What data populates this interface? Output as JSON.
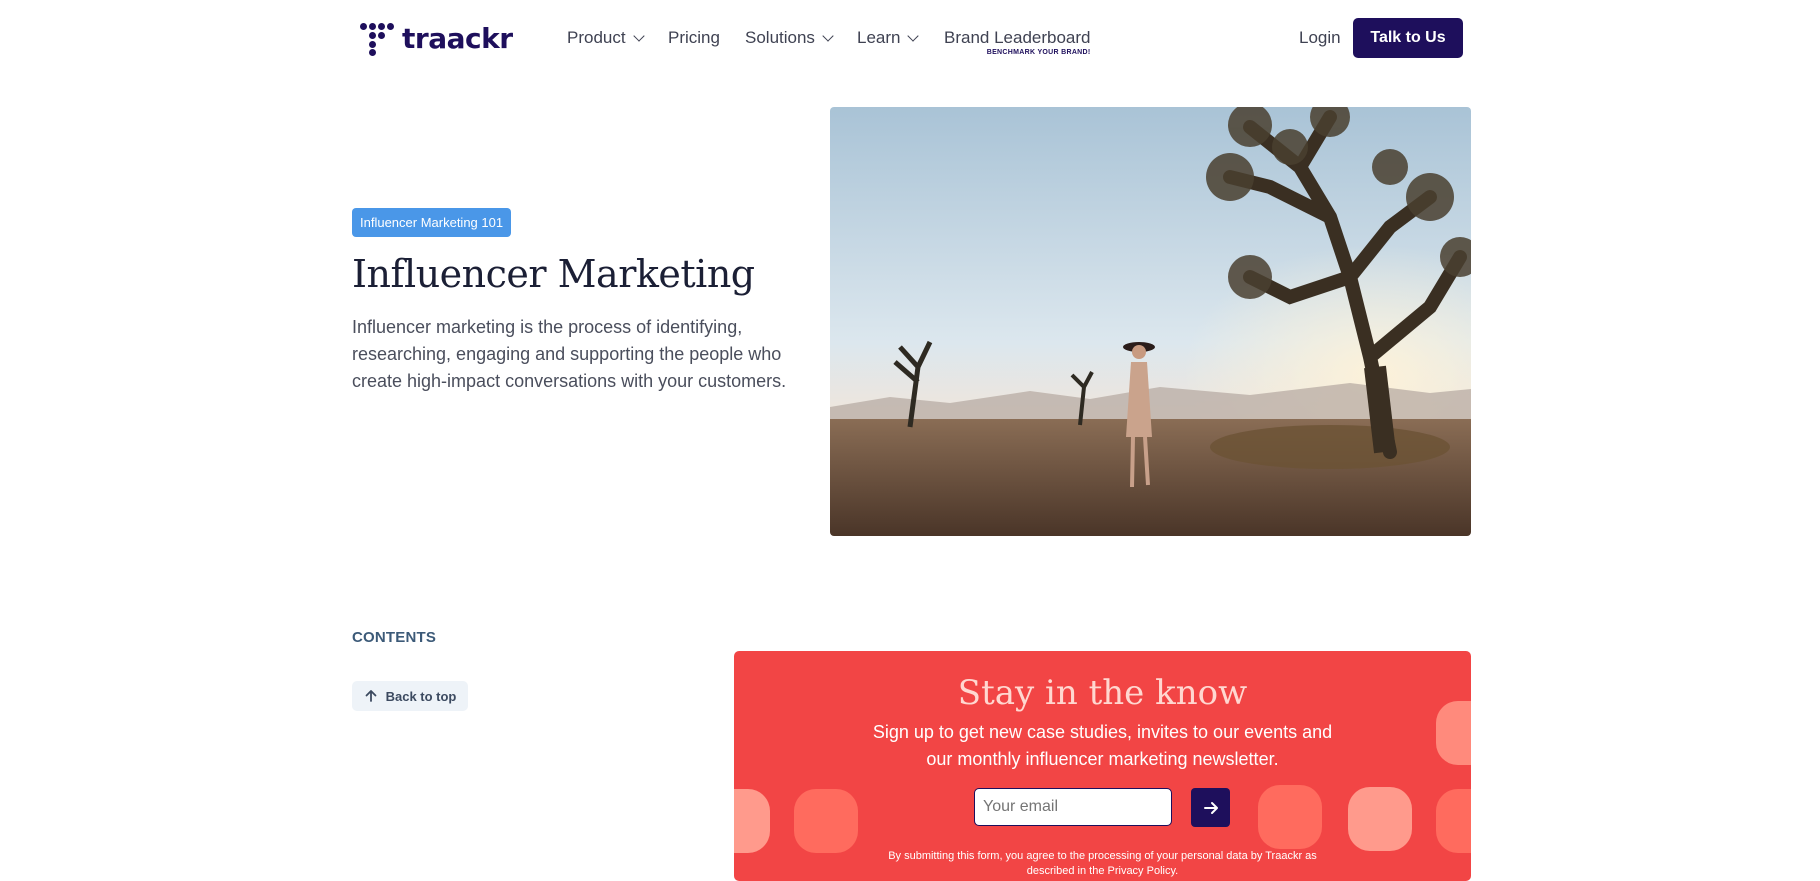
{
  "header": {
    "logo_text": "traackr",
    "nav": [
      {
        "label": "Product",
        "has_dropdown": true
      },
      {
        "label": "Pricing",
        "has_dropdown": false
      },
      {
        "label": "Solutions",
        "has_dropdown": true
      },
      {
        "label": "Learn",
        "has_dropdown": true
      }
    ],
    "brand_leaderboard": {
      "label": "Brand Leaderboard",
      "sub": "BENCHMARK YOUR BRAND!"
    },
    "login_label": "Login",
    "cta_label": "Talk to Us"
  },
  "hero": {
    "badge": "Influencer Marketing 101",
    "title": "Influencer Marketing",
    "description": "Influencer marketing is the process of identifying, researching, engaging and supporting the people who create high-impact conversations with your customers."
  },
  "contents": {
    "heading": "CONTENTS",
    "back_to_top": "Back to top"
  },
  "newsletter": {
    "title": "Stay in the know",
    "subtitle": "Sign up to get new case studies, invites to our events and our monthly influencer marketing newsletter.",
    "email_placeholder": "Your email",
    "legal": "By submitting this form, you agree to the processing of your personal data by Traackr as described in the Privacy Policy."
  },
  "colors": {
    "brand": "#1e0f5c",
    "badge": "#4a97e8",
    "newsletter_bg": "#f24545"
  }
}
